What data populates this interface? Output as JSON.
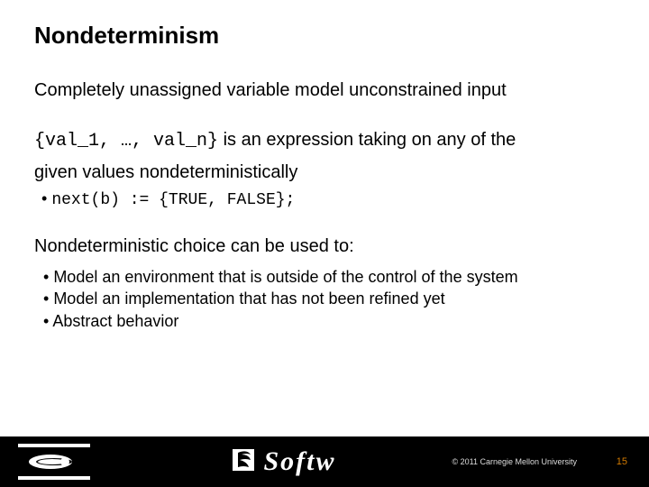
{
  "title": "Nondeterminism",
  "line1": "Completely unassigned variable model unconstrained input",
  "expr": {
    "code": "{val_1, …, val_n}",
    "tail": " is an expression taking on any of the",
    "desc": "given values nondeterministically"
  },
  "codeBullet": "next(b) := {TRUE, FALSE};",
  "usedTo": "Nondeterministic choice can be used to:",
  "uses": [
    "Model an environment that is outside of the control of the system",
    "Model an implementation that has not been refined yet",
    "Abstract behavior"
  ],
  "footer": {
    "wordmark": "Softw",
    "copyright": "© 2011 Carnegie Mellon University",
    "page": "15"
  }
}
